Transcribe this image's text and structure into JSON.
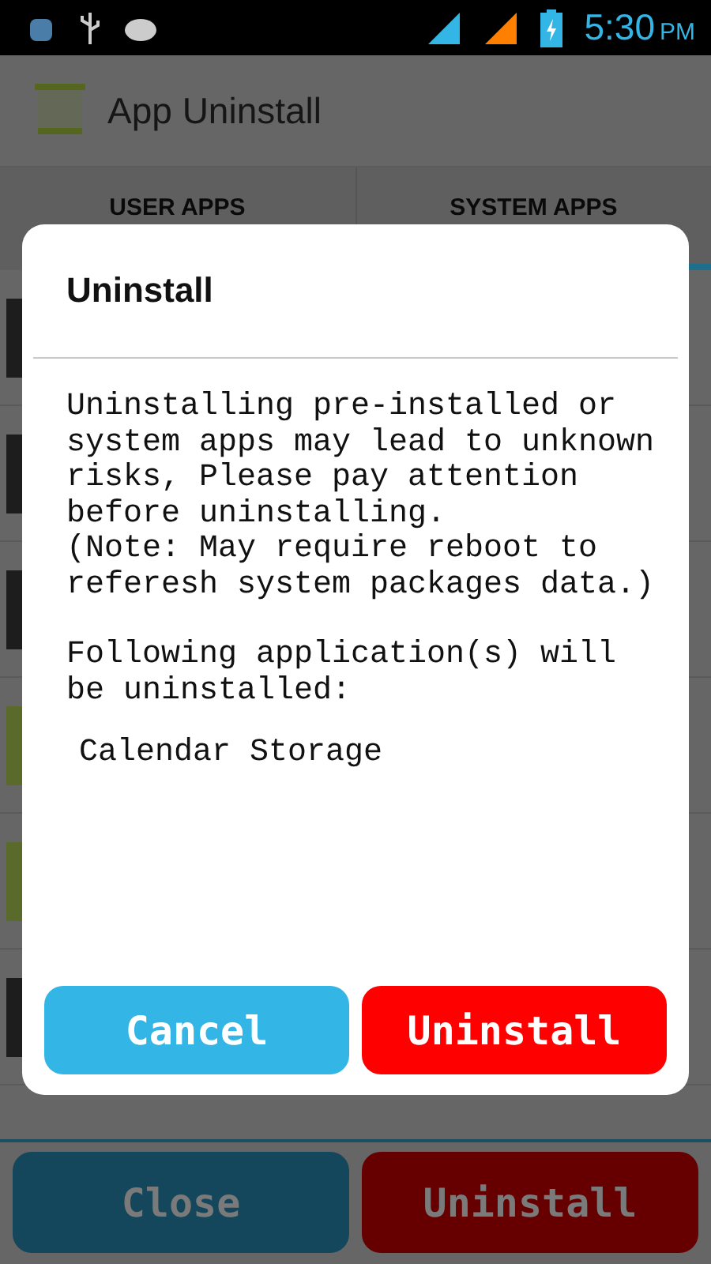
{
  "status_bar": {
    "time": "5:30",
    "ampm": "PM"
  },
  "action_bar": {
    "title": "App Uninstall"
  },
  "tabs": [
    {
      "label": "USER APPS",
      "selected": false
    },
    {
      "label": "SYSTEM APPS",
      "selected": true
    }
  ],
  "dialog": {
    "title": "Uninstall",
    "warning": "Uninstalling pre-installed or system apps may lead to unknown risks, Please pay attention before uninstalling.",
    "note": "(Note: May require reboot to referesh system packages data.)",
    "list_label": "Following application(s) will be uninstalled:",
    "apps": [
      "Calendar Storage"
    ],
    "buttons": [
      {
        "label": "Cancel",
        "kind": "cancel"
      },
      {
        "label": "Uninstall",
        "kind": "confirm"
      }
    ]
  },
  "bottom_buttons": [
    {
      "label": "Close",
      "kind": "cancel"
    },
    {
      "label": "Uninstall",
      "kind": "confirm"
    }
  ]
}
